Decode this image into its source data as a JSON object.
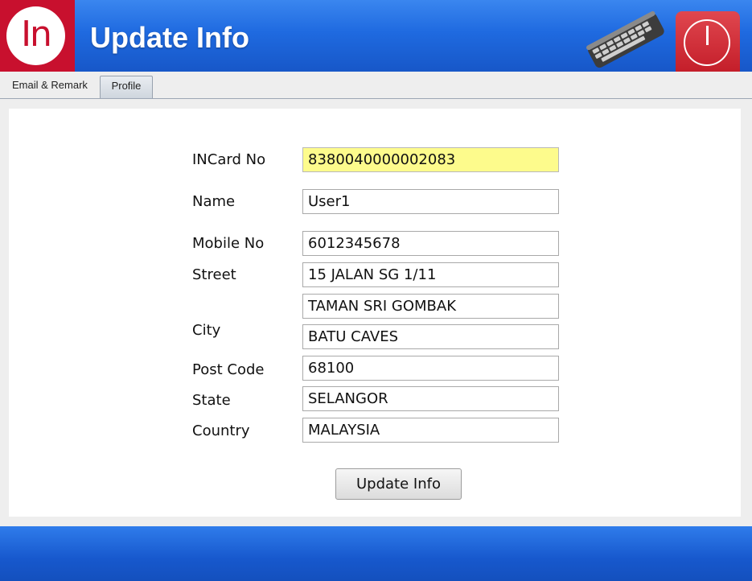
{
  "header": {
    "logo_text": "In",
    "title": "Update Info"
  },
  "tabs": [
    {
      "label": "Email & Remark"
    },
    {
      "label": "Profile"
    }
  ],
  "form": {
    "incard_no": {
      "label": "INCard No",
      "value": "8380040000002083"
    },
    "name": {
      "label": "Name",
      "value": "User1"
    },
    "mobile_no": {
      "label": "Mobile No",
      "value": "6012345678"
    },
    "street": {
      "label": "Street",
      "value": "15 JALAN SG 1/11",
      "value2": "TAMAN SRI GOMBAK"
    },
    "city": {
      "label": "City",
      "value": "BATU CAVES"
    },
    "post_code": {
      "label": "Post Code",
      "value": "68100"
    },
    "state": {
      "label": "State",
      "value": "SELANGOR"
    },
    "country": {
      "label": "Country",
      "value": "MALAYSIA"
    }
  },
  "buttons": {
    "update_label": "Update Info"
  },
  "colors": {
    "header_blue": "#1f6ae0",
    "logo_red": "#c8102e",
    "highlight_yellow": "#fdfb8c"
  },
  "icons": {
    "keyboard": "keyboard-icon",
    "power": "power-icon"
  }
}
